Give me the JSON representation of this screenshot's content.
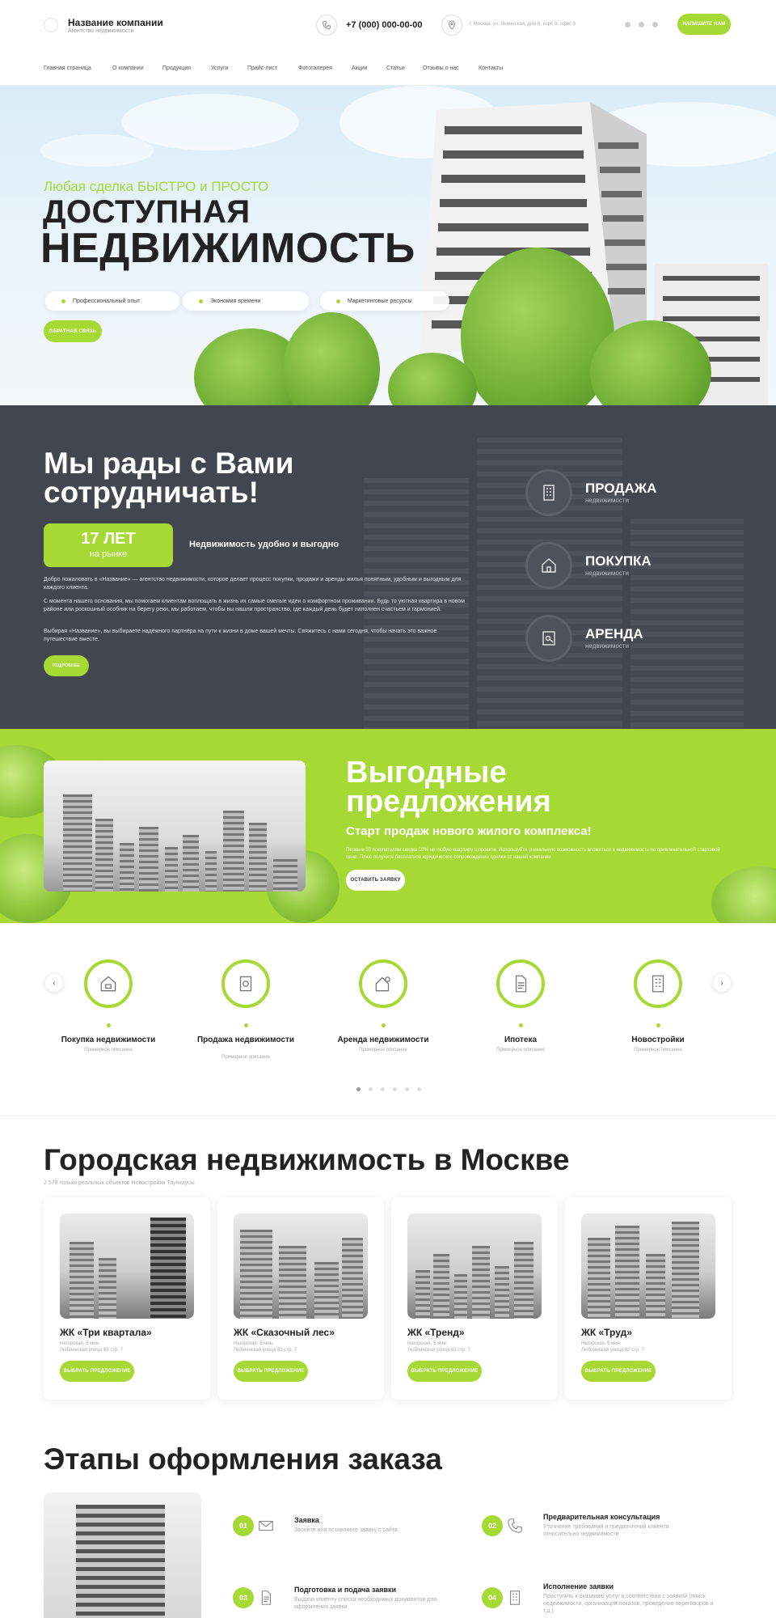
{
  "header": {
    "company_name": "Название компании",
    "company_sub": "Агентство недвижимости",
    "phone": "+7 (000) 000-00-00",
    "address": "г. Москва, ул. Ленинская, дом 0, корп 0, офис 0",
    "cta": "Напишите нам"
  },
  "nav": [
    "Главная страница",
    "О компании",
    "Продукция",
    "Услуги",
    "Прайс-лист",
    "Фотогалерея",
    "Акции",
    "Статьи",
    "Отзывы о нас",
    "Контакты"
  ],
  "hero": {
    "kicker": "Любая сделка БЫСТРО и ПРОСТО",
    "title_1": "ДОСТУПНАЯ",
    "title_2": "НЕДВИЖИМОСТЬ",
    "features": [
      "Профессиональный опыт",
      "Экономия времени",
      "Маркетинговые ресурсы"
    ],
    "button": "Обратная связь"
  },
  "about": {
    "title": "Мы рады с Вами сотрудничать!",
    "years_num": "17 ЛЕТ",
    "years_label": "на рынке",
    "caption": "Недвижимость удобно и выгодно",
    "p1": "Добро пожаловать в «Название» — агентство недвижимости, которое делает процесс покупки, продажи и аренды жилья понятным, удобным и выгодным для каждого клиента.",
    "p2": "С момента нашего основания, мы помогаем клиентам воплощать в жизнь их самые смелые идеи о комфортном проживании. Будь то уютная квартира в новом районе или роскошный особняк на берегу реки, мы работаем, чтобы вы нашли пространство, где каждый день будет наполнен счастьем и гармонией.",
    "p3": "Выбирая «Название», вы выбираете надёжного партнёра на пути к жизни в доме вашей мечты. Свяжитесь с нами сегодня, чтобы начать это важное путешествие вместе.",
    "button": "Подробнее",
    "services": [
      {
        "title": "ПРОДАЖА",
        "sub": "недвижимости",
        "icon": "building-icon"
      },
      {
        "title": "ПОКУПКА",
        "sub": "недвижимости",
        "icon": "house-icon"
      },
      {
        "title": "АРЕНДА",
        "sub": "недвижимости",
        "icon": "key-document-icon"
      }
    ]
  },
  "offer": {
    "title": "Выгодные предложения",
    "subtitle": "Старт продаж нового жилого комплекса!",
    "text": "Первым 10 покупателям скидка 10% на любую квартиру в проекте. Используйте уникальную возможность вложиться в недвижимость по привлекательной стартовой цене. Плюс получите бесплатное юридическое сопровождение сделки от нашей компании",
    "button": "Оставить заявку"
  },
  "categories": [
    {
      "title": "Покупка недвижимости",
      "sub": "Примерное описание",
      "icon": "house-purchase-icon"
    },
    {
      "title": "Продажа недвижимости",
      "sub": "Примерное описание",
      "icon": "price-tag-icon"
    },
    {
      "title": "Аренда недвижимости",
      "sub": "Примерное описание",
      "icon": "house-key-icon"
    },
    {
      "title": "Ипотека",
      "sub": "Примерное описание",
      "icon": "document-icon"
    },
    {
      "title": "Новостройки",
      "sub": "Примерное описание",
      "icon": "apartment-building-icon"
    }
  ],
  "city": {
    "title": "Городская недвижимость в Москве",
    "subtitle": "2 578 только реальных объектов Новостройки Таунхаусы",
    "cards": [
      {
        "title": "ЖК «Три квартала»",
        "line1": "Нагорская, 5 мин.",
        "line2": "Люблинская улица 82 стр. 7",
        "button": "Выбрать предложение"
      },
      {
        "title": "ЖК «Сказочный лес»",
        "line1": "Нагорская, 5 мин.",
        "line2": "Люблинская улица 82 стр. 7",
        "button": "Выбрать предложение"
      },
      {
        "title": "ЖК «Тренд»",
        "line1": "Нагорская, 5 мин.",
        "line2": "Люблинская улица 82 стр. 7",
        "button": "Выбрать предложение"
      },
      {
        "title": "ЖК «Труд»",
        "line1": "Нагорская, 5 мин.",
        "line2": "Люблинская улица 82 стр. 7",
        "button": "Выбрать предложение"
      }
    ]
  },
  "stages": {
    "title": "Этапы оформления заказа",
    "items": [
      {
        "num": "01",
        "title": "Заявка",
        "desc": "Звоните или оставляете заявку с сайта"
      },
      {
        "num": "02",
        "title": "Предварительная консультация",
        "desc": "Уточнение требований и предпочтений клиента относительно недвижимости"
      },
      {
        "num": "03",
        "title": "Подготовка и подача заявки",
        "desc": "Выдача клиенту списка необходимых документов для оформления заявки"
      },
      {
        "num": "04",
        "title": "Исполнение заявки",
        "desc": "Приступить к оказанию услуг в соответствии с заявкой (поиск недвижимости, организация показов, проведение переговоров и т.д.)"
      }
    ]
  },
  "colors": {
    "accent": "#a6d933",
    "dark": "#42464f"
  }
}
